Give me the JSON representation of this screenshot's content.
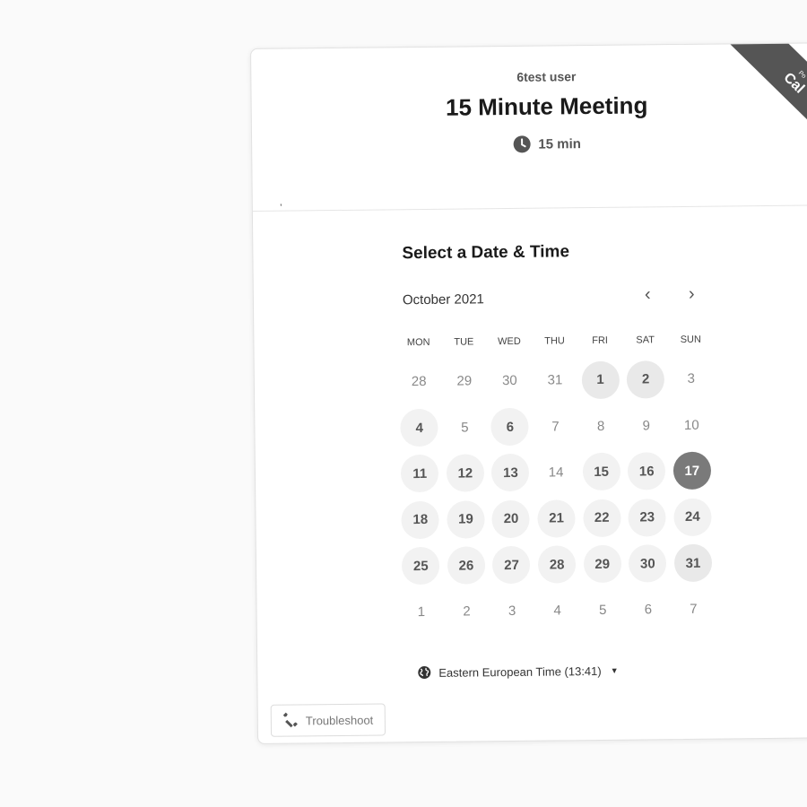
{
  "event": {
    "owner": "6test user",
    "title": "15 Minute Meeting",
    "duration": "15 min",
    "description_mark": ","
  },
  "ribbon": {
    "small": "Po",
    "text": "Cal"
  },
  "calendar": {
    "heading": "Select a Date & Time",
    "month_label": "October 2021",
    "prev_label": "‹",
    "next_label": "›",
    "weekdays": [
      "MON",
      "TUE",
      "WED",
      "THU",
      "FRI",
      "SAT",
      "SUN"
    ],
    "weeks": [
      [
        {
          "d": "28",
          "s": "out"
        },
        {
          "d": "29",
          "s": "out"
        },
        {
          "d": "30",
          "s": "out"
        },
        {
          "d": "31",
          "s": "out"
        },
        {
          "d": "1",
          "s": "dim"
        },
        {
          "d": "2",
          "s": "dim"
        },
        {
          "d": "3",
          "s": "off"
        }
      ],
      [
        {
          "d": "4",
          "s": "avail"
        },
        {
          "d": "5",
          "s": "off"
        },
        {
          "d": "6",
          "s": "avail"
        },
        {
          "d": "7",
          "s": "off"
        },
        {
          "d": "8",
          "s": "off"
        },
        {
          "d": "9",
          "s": "off"
        },
        {
          "d": "10",
          "s": "off"
        }
      ],
      [
        {
          "d": "11",
          "s": "avail"
        },
        {
          "d": "12",
          "s": "avail"
        },
        {
          "d": "13",
          "s": "avail"
        },
        {
          "d": "14",
          "s": "off"
        },
        {
          "d": "15",
          "s": "avail"
        },
        {
          "d": "16",
          "s": "avail"
        },
        {
          "d": "17",
          "s": "selected"
        }
      ],
      [
        {
          "d": "18",
          "s": "avail"
        },
        {
          "d": "19",
          "s": "avail"
        },
        {
          "d": "20",
          "s": "avail"
        },
        {
          "d": "21",
          "s": "avail"
        },
        {
          "d": "22",
          "s": "avail"
        },
        {
          "d": "23",
          "s": "avail"
        },
        {
          "d": "24",
          "s": "avail"
        }
      ],
      [
        {
          "d": "25",
          "s": "avail"
        },
        {
          "d": "26",
          "s": "avail"
        },
        {
          "d": "27",
          "s": "avail"
        },
        {
          "d": "28",
          "s": "avail"
        },
        {
          "d": "29",
          "s": "avail"
        },
        {
          "d": "30",
          "s": "avail"
        },
        {
          "d": "31",
          "s": "dim"
        }
      ],
      [
        {
          "d": "1",
          "s": "out"
        },
        {
          "d": "2",
          "s": "out"
        },
        {
          "d": "3",
          "s": "out"
        },
        {
          "d": "4",
          "s": "out"
        },
        {
          "d": "5",
          "s": "out"
        },
        {
          "d": "6",
          "s": "out"
        },
        {
          "d": "7",
          "s": "out"
        }
      ]
    ]
  },
  "timezone": {
    "label": "Eastern European Time (13:41)"
  },
  "troubleshoot": {
    "label": "Troubleshoot"
  },
  "colors": {
    "selected": "#7a7a7a",
    "available": "#f2f2f2",
    "ribbon": "#555555"
  }
}
